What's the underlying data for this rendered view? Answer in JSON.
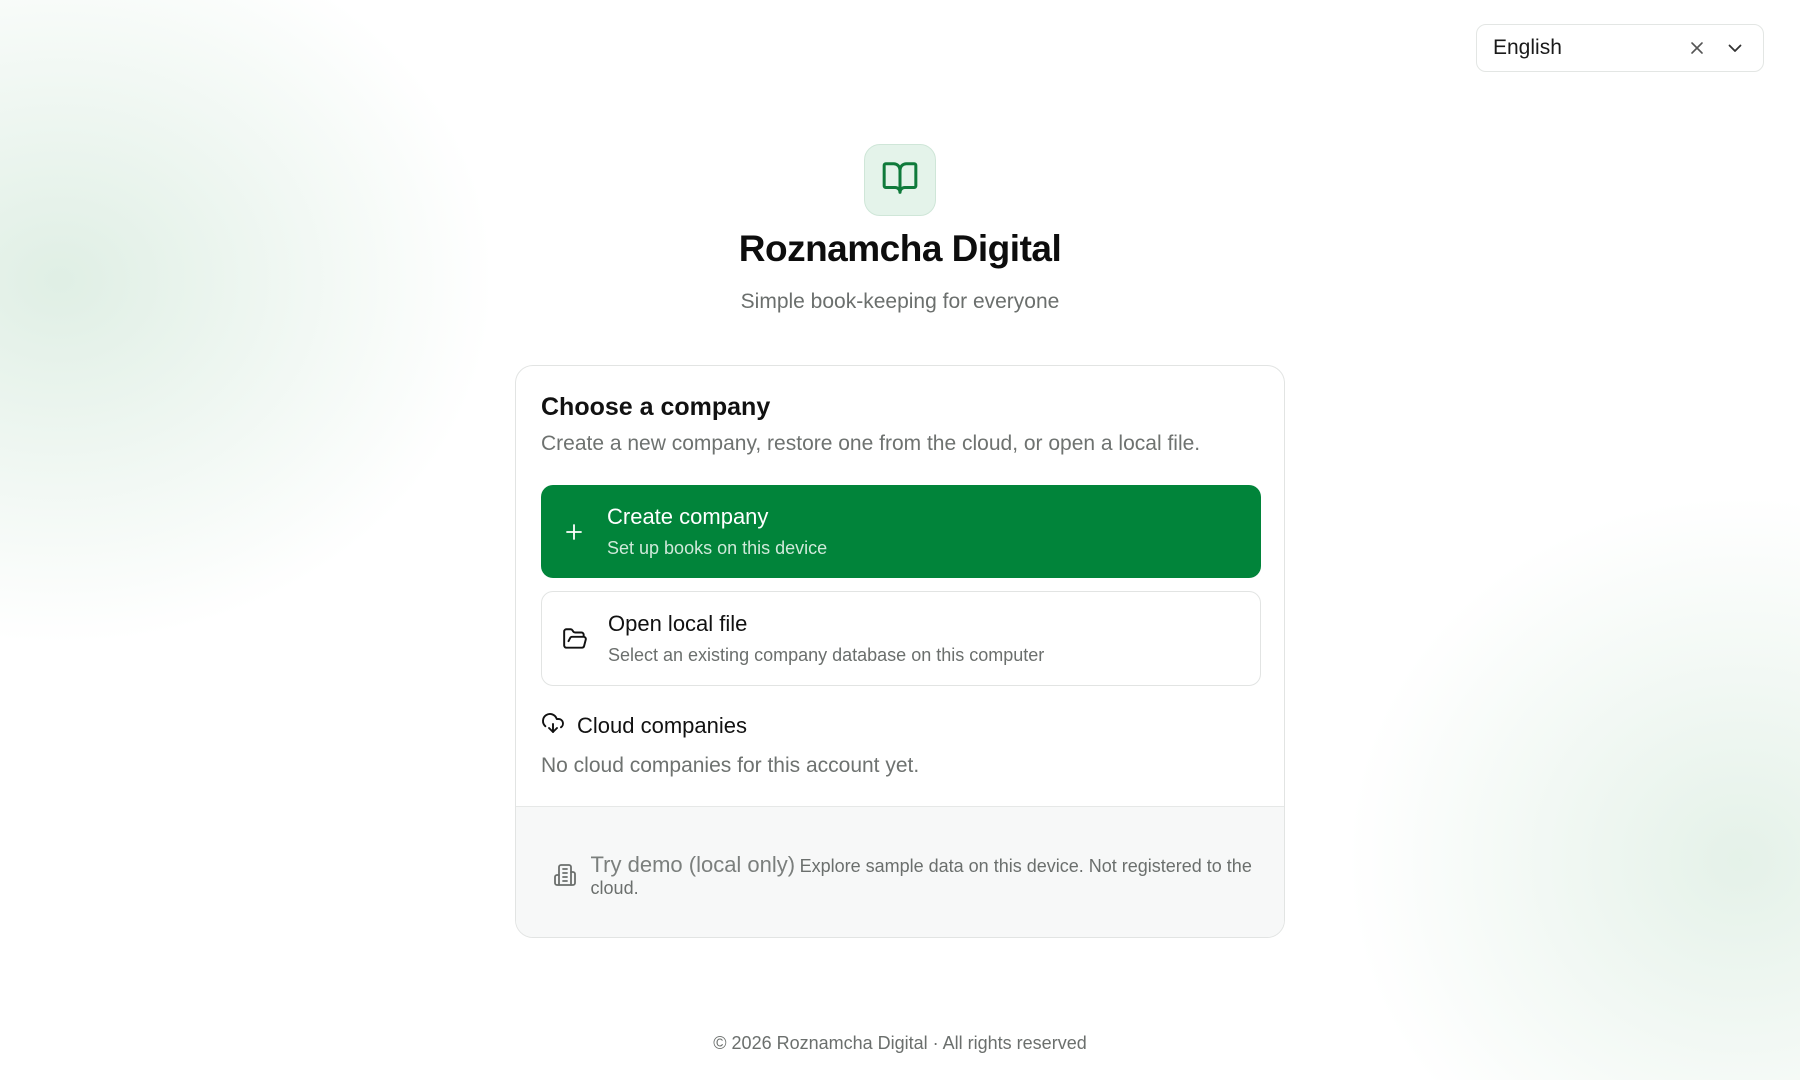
{
  "language_select": {
    "value": "English"
  },
  "header": {
    "app_title": "Roznamcha Digital",
    "tagline": "Simple book-keeping for everyone",
    "logo_icon": "book-open-icon"
  },
  "card": {
    "title": "Choose a company",
    "description": "Create a new company, restore one from the cloud, or open a local file.",
    "options": {
      "create": {
        "icon": "plus-icon",
        "title": "Create company",
        "subtitle": "Set up books on this device"
      },
      "open": {
        "icon": "folder-open-icon",
        "title": "Open local file",
        "subtitle": "Select an existing company database on this computer"
      }
    },
    "cloud": {
      "icon": "cloud-download-icon",
      "heading": "Cloud companies",
      "empty_message": "No cloud companies for this account yet."
    },
    "demo": {
      "icon": "building-icon",
      "title": "Try demo (local only)",
      "subtitle": "Explore sample data on this device. Not registered to the cloud."
    }
  },
  "footer": {
    "text": "© 2026 Roznamcha Digital · All rights reserved"
  },
  "colors": {
    "primary": "#01843a",
    "logo_bg": "#e4f3ea",
    "muted_text": "#6e7270"
  }
}
